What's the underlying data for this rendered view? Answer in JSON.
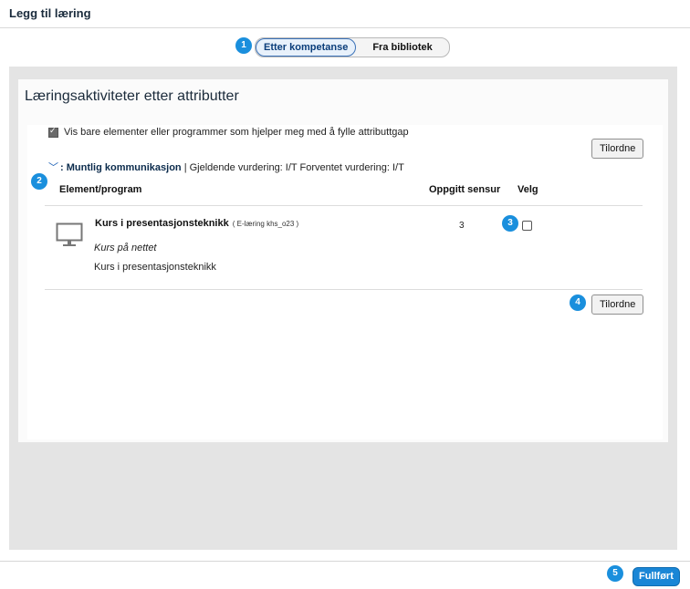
{
  "header": {
    "title": "Legg til læring"
  },
  "segment": {
    "options": [
      "Etter kompetanse",
      "Fra bibliotek"
    ],
    "selected": "Etter kompetanse"
  },
  "badges": [
    "1",
    "2",
    "3",
    "4",
    "5"
  ],
  "panel": {
    "title": "Læringsaktiviteter etter attributter",
    "filter_checkbox_label": "Vis bare elementer eller programmer som hjelper meg med å fylle attributtgap",
    "filter_checked": true,
    "assign_button_top": "Tilordne",
    "assign_button_bottom": "Tilordne",
    "attribute": {
      "prefix": ":",
      "name": "Muntlig kommunikasjon",
      "details": "| Gjeldende vurdering: I/T Forventet vurdering: I/T"
    },
    "table": {
      "columns": [
        "Element/program",
        "Oppgitt sensur",
        "Velg"
      ],
      "rows": [
        {
          "icon": "monitor-icon",
          "title": "Kurs i presentasjonsteknikk",
          "subtitle": "( E-læring khs_o23 )",
          "type": "Kurs på nettet",
          "description": "Kurs i presentasjonsteknikk",
          "sensur": "3",
          "selected": false
        }
      ]
    }
  },
  "footer": {
    "done_label": "Fullført"
  },
  "colors": {
    "accent": "#1a8fdd",
    "primary_button": "#1a86d6",
    "background_panel": "#e4e4e4"
  }
}
